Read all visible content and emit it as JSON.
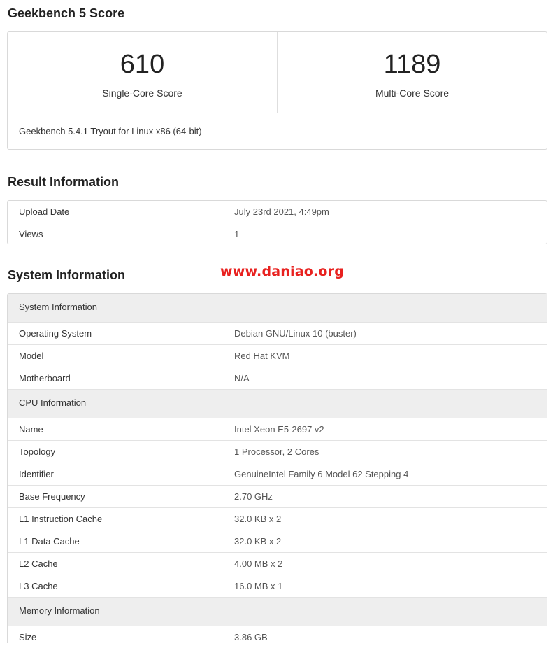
{
  "score": {
    "heading": "Geekbench 5 Score",
    "single_value": "610",
    "single_label": "Single-Core Score",
    "multi_value": "1189",
    "multi_label": "Multi-Core Score",
    "footer": "Geekbench 5.4.1 Tryout for Linux x86 (64-bit)"
  },
  "result": {
    "heading": "Result Information",
    "rows": [
      {
        "label": "Upload Date",
        "value": "July 23rd 2021, 4:49pm"
      },
      {
        "label": "Views",
        "value": "1"
      }
    ]
  },
  "watermark": "www.daniao.org",
  "system": {
    "heading": "System Information",
    "sections": [
      {
        "title": "System Information",
        "rows": [
          {
            "label": "Operating System",
            "value": "Debian GNU/Linux 10 (buster)"
          },
          {
            "label": "Model",
            "value": "Red Hat KVM"
          },
          {
            "label": "Motherboard",
            "value": "N/A"
          }
        ]
      },
      {
        "title": "CPU Information",
        "rows": [
          {
            "label": "Name",
            "value": "Intel Xeon E5-2697 v2"
          },
          {
            "label": "Topology",
            "value": "1 Processor, 2 Cores"
          },
          {
            "label": "Identifier",
            "value": "GenuineIntel Family 6 Model 62 Stepping 4"
          },
          {
            "label": "Base Frequency",
            "value": "2.70 GHz"
          },
          {
            "label": "L1 Instruction Cache",
            "value": "32.0 KB x 2"
          },
          {
            "label": "L1 Data Cache",
            "value": "32.0 KB x 2"
          },
          {
            "label": "L2 Cache",
            "value": "4.00 MB x 2"
          },
          {
            "label": "L3 Cache",
            "value": "16.0 MB x 1"
          }
        ]
      },
      {
        "title": "Memory Information",
        "rows": [
          {
            "label": "Size",
            "value": "3.86 GB"
          }
        ]
      }
    ]
  }
}
